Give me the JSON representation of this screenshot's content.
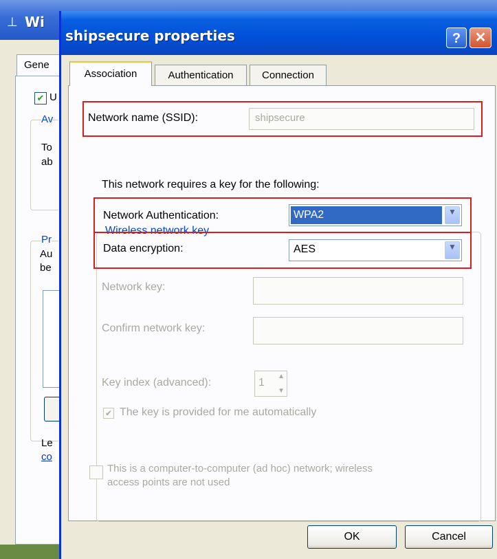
{
  "background_window": {
    "title": "Wi",
    "tab_label": "Gene",
    "checkbox_label": "U",
    "group1_title": "Av",
    "group1_lines": [
      "To",
      "ab"
    ],
    "group2_title": "Pr",
    "group2_lines": [
      "Au",
      "be"
    ],
    "footer_text": "Le",
    "footer_link": "co"
  },
  "dialog": {
    "title": "shipsecure properties",
    "help_label": "?",
    "close_label": "✕"
  },
  "tabs": [
    "Association",
    "Authentication",
    "Connection"
  ],
  "association": {
    "ssid_label": "Network name (SSID):",
    "ssid_value": "shipsecure",
    "key_group_title": "Wireless network key",
    "requires_text": "This network requires a key for the following:",
    "auth_label": "Network Authentication:",
    "auth_value": "WPA2",
    "enc_label": "Data encryption:",
    "enc_value": "AES",
    "network_key_label": "Network key:",
    "confirm_key_label": "Confirm network key:",
    "key_index_label": "Key index (advanced):",
    "key_index_value": "1",
    "auto_key_label": "The key is provided for me automatically",
    "adhoc_line1": "This is a computer-to-computer (ad hoc) network; wireless",
    "adhoc_line2": "access points are not used"
  },
  "buttons": {
    "ok": "OK",
    "cancel": "Cancel"
  },
  "colors": {
    "highlight_box": "#d91c1c",
    "selection": "#316ac5",
    "title_bar": "#0050d8"
  }
}
